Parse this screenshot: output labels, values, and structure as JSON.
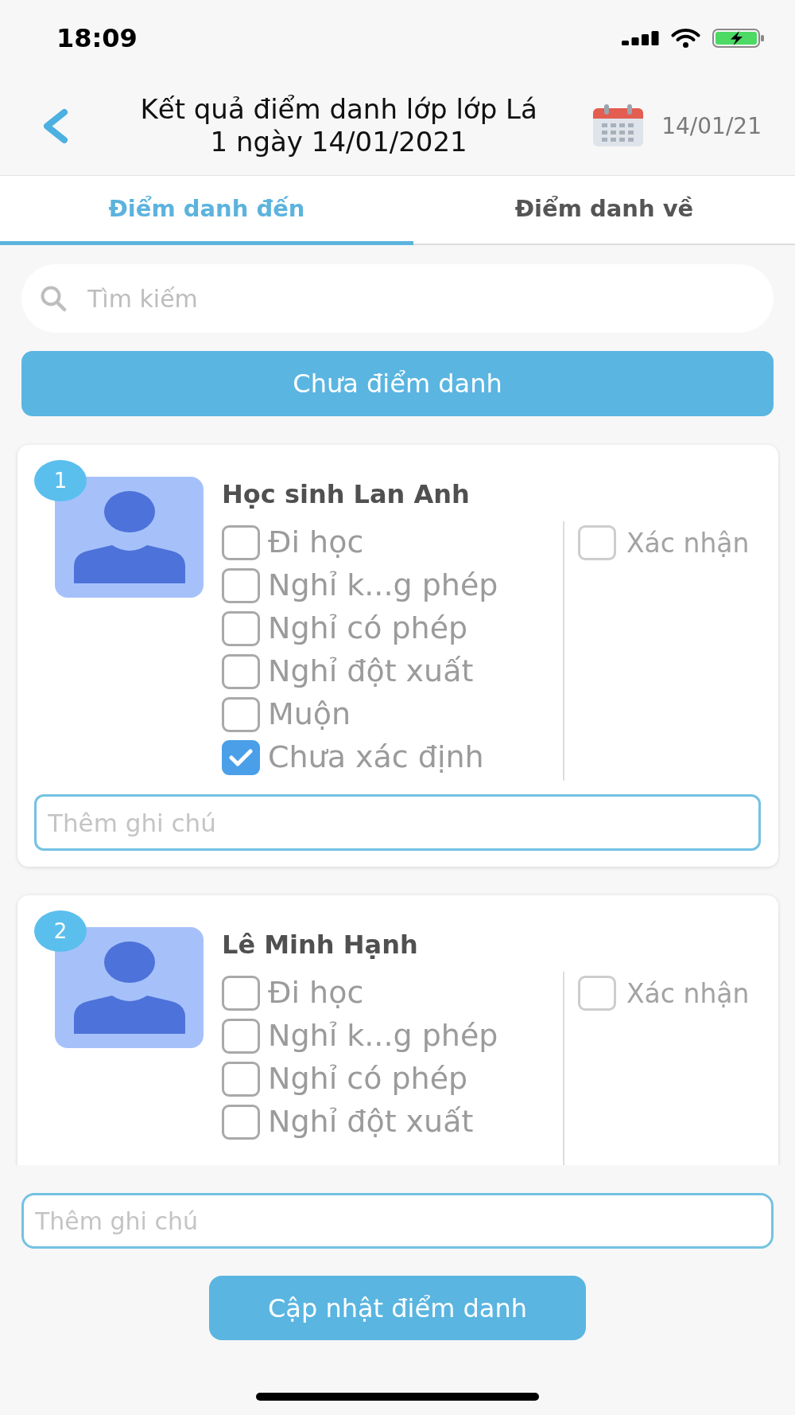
{
  "status_bar": {
    "time": "18:09"
  },
  "header": {
    "title": "Kết quả điểm danh lớp lớp Lá 1 ngày 14/01/2021",
    "date": "14/01/21"
  },
  "tabs": [
    {
      "label": "Điểm danh đến",
      "selected": true
    },
    {
      "label": "Điểm danh về",
      "selected": false
    }
  ],
  "search": {
    "placeholder": "Tìm kiếm"
  },
  "filter_button": {
    "label": "Chưa điểm danh"
  },
  "students": [
    {
      "number": "1",
      "name": "Học sinh Lan Anh",
      "options": [
        {
          "label": "Đi học",
          "checked": false
        },
        {
          "label": "Nghỉ k...g phép",
          "checked": false
        },
        {
          "label": "Nghỉ có phép",
          "checked": false
        },
        {
          "label": "Nghỉ đột xuất",
          "checked": false
        },
        {
          "label": "Muộn",
          "checked": false
        },
        {
          "label": "Chưa xác định",
          "checked": true
        }
      ],
      "confirm": {
        "label": "Xác nhận",
        "checked": false
      },
      "note": {
        "placeholder": "Thêm ghi chú"
      }
    },
    {
      "number": "2",
      "name": "Lê Minh Hạnh",
      "options": [
        {
          "label": "Đi học",
          "checked": false
        },
        {
          "label": "Nghỉ k...g phép",
          "checked": false
        },
        {
          "label": "Nghỉ có phép",
          "checked": false
        },
        {
          "label": "Nghỉ đột xuất",
          "checked": false
        }
      ],
      "confirm": {
        "label": "Xác nhận",
        "checked": false
      }
    }
  ],
  "footer": {
    "note": {
      "placeholder": "Thêm ghi chú"
    },
    "update_button": {
      "label": "Cập nhật điểm danh"
    }
  }
}
